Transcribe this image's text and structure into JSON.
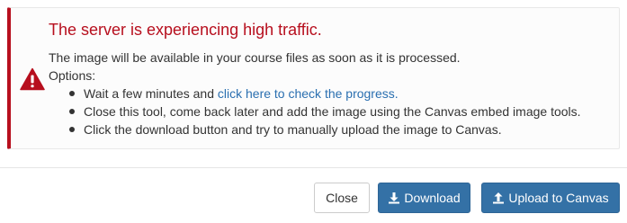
{
  "alert": {
    "title": "The server is experiencing high traffic.",
    "message": "The image will be available in your course files as soon as it is processed.",
    "options_label": "Options:",
    "options": [
      {
        "prefix": "Wait a few minutes and ",
        "link": "click here to check the progress."
      },
      {
        "text": "Close this tool, come back later and add the image using the Canvas embed image tools."
      },
      {
        "text": "Click the download button and try to manually upload the image to Canvas."
      }
    ],
    "icon": "warning-triangle-icon",
    "accent_color": "#b70f1e"
  },
  "footer": {
    "close_label": "Close",
    "download_label": "Download",
    "upload_label": "Upload to Canvas",
    "primary_color": "#3471a6"
  }
}
